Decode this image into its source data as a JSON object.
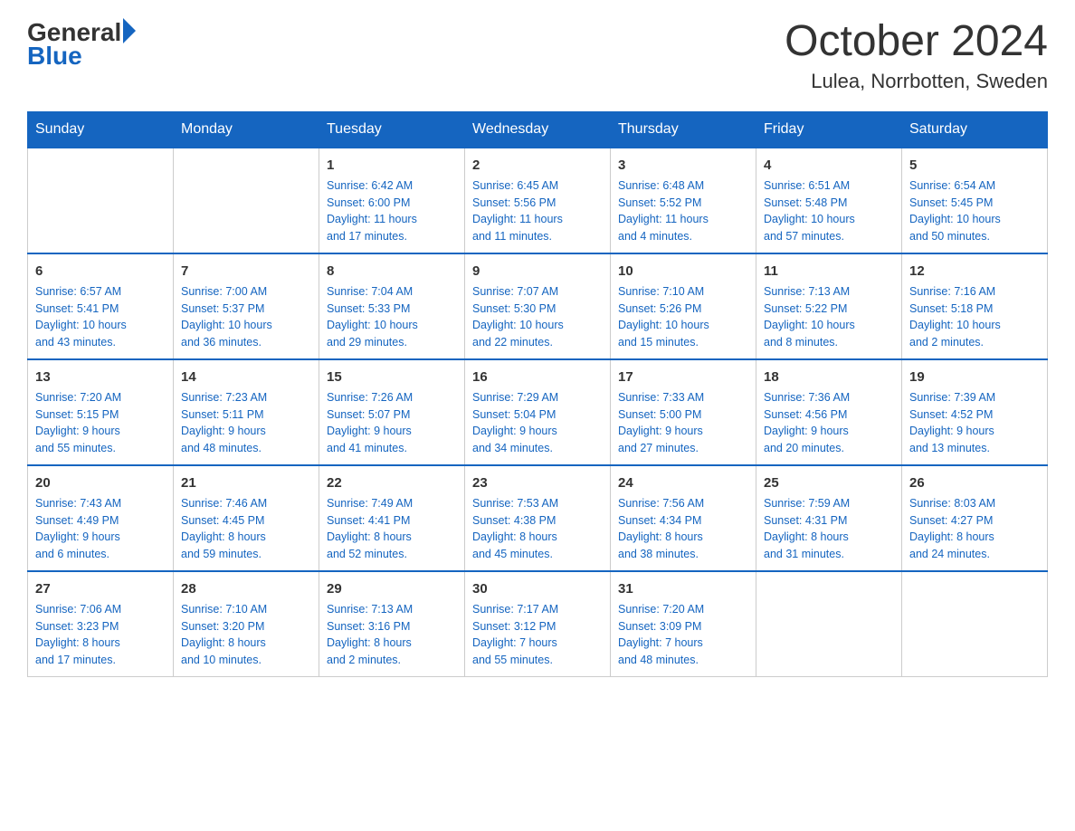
{
  "logo": {
    "general": "General",
    "arrow": "▶",
    "blue": "Blue"
  },
  "header": {
    "month_year": "October 2024",
    "location": "Lulea, Norrbotten, Sweden"
  },
  "days_of_week": [
    "Sunday",
    "Monday",
    "Tuesday",
    "Wednesday",
    "Thursday",
    "Friday",
    "Saturday"
  ],
  "weeks": [
    [
      {
        "day": "",
        "info": ""
      },
      {
        "day": "",
        "info": ""
      },
      {
        "day": "1",
        "info": "Sunrise: 6:42 AM\nSunset: 6:00 PM\nDaylight: 11 hours\nand 17 minutes."
      },
      {
        "day": "2",
        "info": "Sunrise: 6:45 AM\nSunset: 5:56 PM\nDaylight: 11 hours\nand 11 minutes."
      },
      {
        "day": "3",
        "info": "Sunrise: 6:48 AM\nSunset: 5:52 PM\nDaylight: 11 hours\nand 4 minutes."
      },
      {
        "day": "4",
        "info": "Sunrise: 6:51 AM\nSunset: 5:48 PM\nDaylight: 10 hours\nand 57 minutes."
      },
      {
        "day": "5",
        "info": "Sunrise: 6:54 AM\nSunset: 5:45 PM\nDaylight: 10 hours\nand 50 minutes."
      }
    ],
    [
      {
        "day": "6",
        "info": "Sunrise: 6:57 AM\nSunset: 5:41 PM\nDaylight: 10 hours\nand 43 minutes."
      },
      {
        "day": "7",
        "info": "Sunrise: 7:00 AM\nSunset: 5:37 PM\nDaylight: 10 hours\nand 36 minutes."
      },
      {
        "day": "8",
        "info": "Sunrise: 7:04 AM\nSunset: 5:33 PM\nDaylight: 10 hours\nand 29 minutes."
      },
      {
        "day": "9",
        "info": "Sunrise: 7:07 AM\nSunset: 5:30 PM\nDaylight: 10 hours\nand 22 minutes."
      },
      {
        "day": "10",
        "info": "Sunrise: 7:10 AM\nSunset: 5:26 PM\nDaylight: 10 hours\nand 15 minutes."
      },
      {
        "day": "11",
        "info": "Sunrise: 7:13 AM\nSunset: 5:22 PM\nDaylight: 10 hours\nand 8 minutes."
      },
      {
        "day": "12",
        "info": "Sunrise: 7:16 AM\nSunset: 5:18 PM\nDaylight: 10 hours\nand 2 minutes."
      }
    ],
    [
      {
        "day": "13",
        "info": "Sunrise: 7:20 AM\nSunset: 5:15 PM\nDaylight: 9 hours\nand 55 minutes."
      },
      {
        "day": "14",
        "info": "Sunrise: 7:23 AM\nSunset: 5:11 PM\nDaylight: 9 hours\nand 48 minutes."
      },
      {
        "day": "15",
        "info": "Sunrise: 7:26 AM\nSunset: 5:07 PM\nDaylight: 9 hours\nand 41 minutes."
      },
      {
        "day": "16",
        "info": "Sunrise: 7:29 AM\nSunset: 5:04 PM\nDaylight: 9 hours\nand 34 minutes."
      },
      {
        "day": "17",
        "info": "Sunrise: 7:33 AM\nSunset: 5:00 PM\nDaylight: 9 hours\nand 27 minutes."
      },
      {
        "day": "18",
        "info": "Sunrise: 7:36 AM\nSunset: 4:56 PM\nDaylight: 9 hours\nand 20 minutes."
      },
      {
        "day": "19",
        "info": "Sunrise: 7:39 AM\nSunset: 4:52 PM\nDaylight: 9 hours\nand 13 minutes."
      }
    ],
    [
      {
        "day": "20",
        "info": "Sunrise: 7:43 AM\nSunset: 4:49 PM\nDaylight: 9 hours\nand 6 minutes."
      },
      {
        "day": "21",
        "info": "Sunrise: 7:46 AM\nSunset: 4:45 PM\nDaylight: 8 hours\nand 59 minutes."
      },
      {
        "day": "22",
        "info": "Sunrise: 7:49 AM\nSunset: 4:41 PM\nDaylight: 8 hours\nand 52 minutes."
      },
      {
        "day": "23",
        "info": "Sunrise: 7:53 AM\nSunset: 4:38 PM\nDaylight: 8 hours\nand 45 minutes."
      },
      {
        "day": "24",
        "info": "Sunrise: 7:56 AM\nSunset: 4:34 PM\nDaylight: 8 hours\nand 38 minutes."
      },
      {
        "day": "25",
        "info": "Sunrise: 7:59 AM\nSunset: 4:31 PM\nDaylight: 8 hours\nand 31 minutes."
      },
      {
        "day": "26",
        "info": "Sunrise: 8:03 AM\nSunset: 4:27 PM\nDaylight: 8 hours\nand 24 minutes."
      }
    ],
    [
      {
        "day": "27",
        "info": "Sunrise: 7:06 AM\nSunset: 3:23 PM\nDaylight: 8 hours\nand 17 minutes."
      },
      {
        "day": "28",
        "info": "Sunrise: 7:10 AM\nSunset: 3:20 PM\nDaylight: 8 hours\nand 10 minutes."
      },
      {
        "day": "29",
        "info": "Sunrise: 7:13 AM\nSunset: 3:16 PM\nDaylight: 8 hours\nand 2 minutes."
      },
      {
        "day": "30",
        "info": "Sunrise: 7:17 AM\nSunset: 3:12 PM\nDaylight: 7 hours\nand 55 minutes."
      },
      {
        "day": "31",
        "info": "Sunrise: 7:20 AM\nSunset: 3:09 PM\nDaylight: 7 hours\nand 48 minutes."
      },
      {
        "day": "",
        "info": ""
      },
      {
        "day": "",
        "info": ""
      }
    ]
  ]
}
